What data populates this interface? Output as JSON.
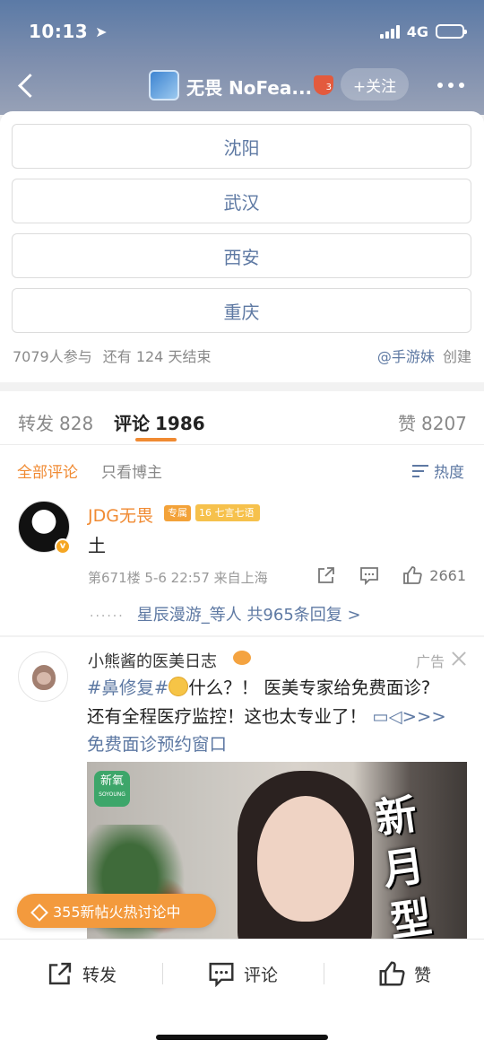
{
  "status_bar": {
    "time": "10:13",
    "network": "4G"
  },
  "nav": {
    "title": "无畏 NoFea...",
    "badge_level": "3",
    "follow_label": "+关注"
  },
  "vote": {
    "options": [
      "沈阳",
      "武汉",
      "西安",
      "重庆"
    ],
    "participants": "7079人参与",
    "remaining": "还有 124 天结束",
    "creator": "@手游妹",
    "created_label": "创建"
  },
  "tabs": {
    "repost": {
      "label": "转发",
      "count": "828"
    },
    "comments": {
      "label": "评论",
      "count": "1986"
    },
    "likes": {
      "label": "赞",
      "count": "8207"
    }
  },
  "filters": {
    "all": "全部评论",
    "owner_only": "只看博主",
    "hot": "热度"
  },
  "comment": {
    "author": "JDG无畏",
    "tag_exclusive": "专属",
    "tag_level_num": "16",
    "tag_level_text": "七言七语",
    "text": "土",
    "meta": "第671楼 5-6 22:57 来自上海",
    "like_count": "2661",
    "replies_text": "星辰漫游_等人 共965条回复 >",
    "replies_dots": "······"
  },
  "ad": {
    "name": "小熊酱的医美日志",
    "label": "广告",
    "line1_tag": "#鼻修复#",
    "line1_text": "什么？！ 医美专家给免费面诊?",
    "line2_text": "还有全程医疗监控！这也太专业了！",
    "line2_link": ">>>",
    "line3_link": "免费面诊预约窗口",
    "brand": "新氧",
    "brand_sub": "SOYOUNG",
    "image_text": "新月型"
  },
  "hot_pill": "355新帖火热讨论中",
  "bottom_bar": {
    "repost": "转发",
    "comment": "评论",
    "like": "赞"
  },
  "colors": {
    "accent_orange": "#f08a32",
    "link_blue": "#5e79a3"
  }
}
